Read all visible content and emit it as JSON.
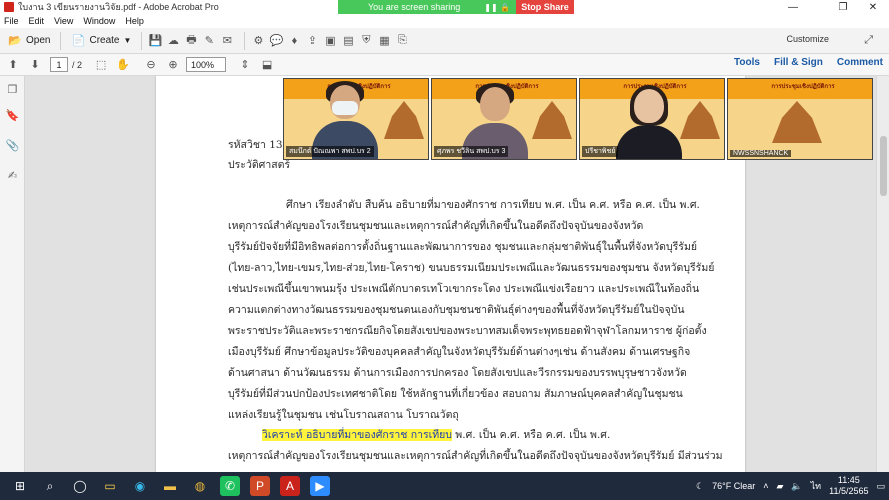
{
  "window": {
    "title": "ใบงาน 3 เขียนรายงานวิจัย.pdf - Adobe Acrobat Pro",
    "share_banner": "You are screen sharing",
    "stop_share": "Stop Share"
  },
  "menu": [
    "File",
    "Edit",
    "View",
    "Window",
    "Help"
  ],
  "toolbar": {
    "open_label": "Open",
    "create_label": "Create",
    "customize_label": "Customize"
  },
  "nav": {
    "page_current": "1",
    "page_total": "/ 2",
    "zoom": "100%",
    "tools": "Tools",
    "fill_sign": "Fill & Sign",
    "comment": "Comment"
  },
  "document": {
    "line_code": "รหัสวิชา 131",
    "line_subject": "ประวัติศาสตร์",
    "paragraph": [
      "ศึกษา เรียงลำดับ สืบค้น อธิบายที่มาของศักราช การเทียบ พ.ศ. เป็น ค.ศ. หรือ ค.ศ. เป็น พ.ศ.",
      "เหตุการณ์สำคัญของโรงเรียนชุมชนและเหตุการณ์สำคัญที่เกิดขึ้นในอดีตถึงปัจจุบันของจังหวัด",
      "บุรีรัมย์ปัจจัยที่มีอิทธิพลต่อการตั้งถิ่นฐานและพัฒนาการของ ชุมชนและกลุ่มชาติพันธุ์ในพื้นที่จังหวัดบุรีรัมย์",
      "(ไทย-ลาว,ไทย-เขมร,ไทย-ส่วย,ไทย-โคราช)   ขนบธรรมเนียมประเพณีและวัฒนธรรมของชุมชน จังหวัดบุรีรัมย์",
      "เช่นประเพณีขึ้นเขาพนมรุ้ง ประเพณีตักบาตรเทโวเขากระโดง ประเพณีแข่งเรือยาว และประเพณีในท้องถิ่น",
      "ความแตกต่างทางวัฒนธรรมของชุมชนตนเองกับชุมชนชาติพันธุ์ต่างๆของพื้นที่จังหวัดบุรีรัมย์ในปัจจุบัน",
      "พระราชประวัติและพระราชกรณียกิจโดยสังเขปของพระบาทสมเด็จพระพุทธยอดฟ้าจุฬาโลกมหาราช ผู้ก่อตั้ง",
      "เมืองบุรีรัมย์ ศึกษาข้อมูลประวัติของบุคคลสำคัญในจังหวัดบุรีรัมย์ด้านต่างๆเช่น ด้านสังคม ด้านเศรษฐกิจ",
      "ด้านศาสนา ด้านวัฒนธรรม ด้านการเมืองการปกครอง โดยสังเขปและวีรกรรมของบรรพบุรุษชาวจังหวัด",
      "บุรีรัมย์ที่มีส่วนปกป้องประเทศชาติโดย ใช้หลักฐานที่เกี่ยวข้อง สอบถาม สัมภาษณ์บุคคลสำคัญในชุมชน",
      "แหล่งเรียนรู้ในชุมชน เช่นโบราณสถาน โบราณวัตถุ"
    ],
    "highlight": "วิเคราะห์ อธิบายที่มาของศักราช การเทียบ",
    "highlight_rest": " พ.ศ. เป็น ค.ศ. หรือ ค.ศ. เป็น พ.ศ.",
    "last_line": "เหตุการณ์สำคัญของโรงเรียนชุมชนและเหตุการณ์สำคัญที่เกิดขึ้นในอดีตถึงปัจจุบันของจังหวัดบุรีรัมย์ มีส่วนร่วม"
  },
  "video_tiles": [
    {
      "name": "สมนึกต์ ปัณณพา สพป.บร 2",
      "slide": "การประชุมเชิงปฏิบัติการ"
    },
    {
      "name": "ศุภพร ชวีลิน สพป.บร 3",
      "slide": "การประชุมเชิงปฏิบัติการ"
    },
    {
      "name": "ปรีชาพิชย์",
      "slide": "การประชุมเชิงปฏิบัติการ"
    },
    {
      "name": "NWSSNSHANCK",
      "slide": "การประชุมเชิงปฏิบัติการ"
    }
  ],
  "taskbar": {
    "weather": "76°F  Clear",
    "time": "11:45",
    "date": "11/5/2565"
  }
}
